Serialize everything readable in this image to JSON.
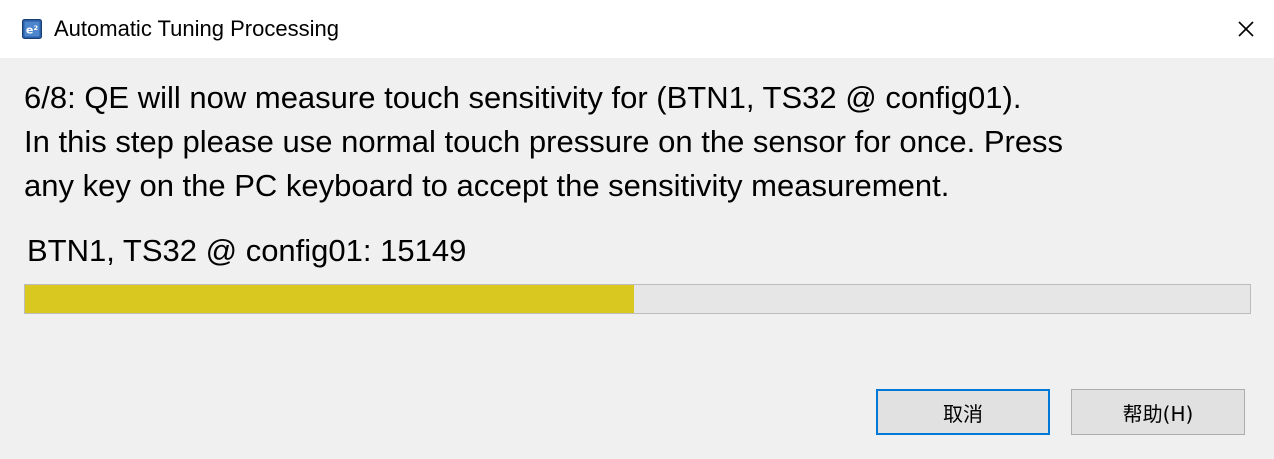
{
  "window": {
    "title": "Automatic Tuning Processing",
    "app_icon": "e2-studio-app-icon",
    "close_icon": "close-icon"
  },
  "message": {
    "lines": [
      "6/8: QE will now measure touch sensitivity for (BTN1, TS32 @ config01).",
      "In this step please use normal touch pressure on the sensor for once. Press",
      "any key on the PC keyboard to accept the sensitivity measurement."
    ]
  },
  "measurement": {
    "label": "BTN1, TS32 @ config01: 15149",
    "progress_fraction": 0.497,
    "progress_color": "#d9c820"
  },
  "buttons": {
    "cancel_label": "取消",
    "help_label": "帮助(H)"
  },
  "colors": {
    "accent": "#0078d7",
    "dialog_bg": "#f0f0f0"
  }
}
